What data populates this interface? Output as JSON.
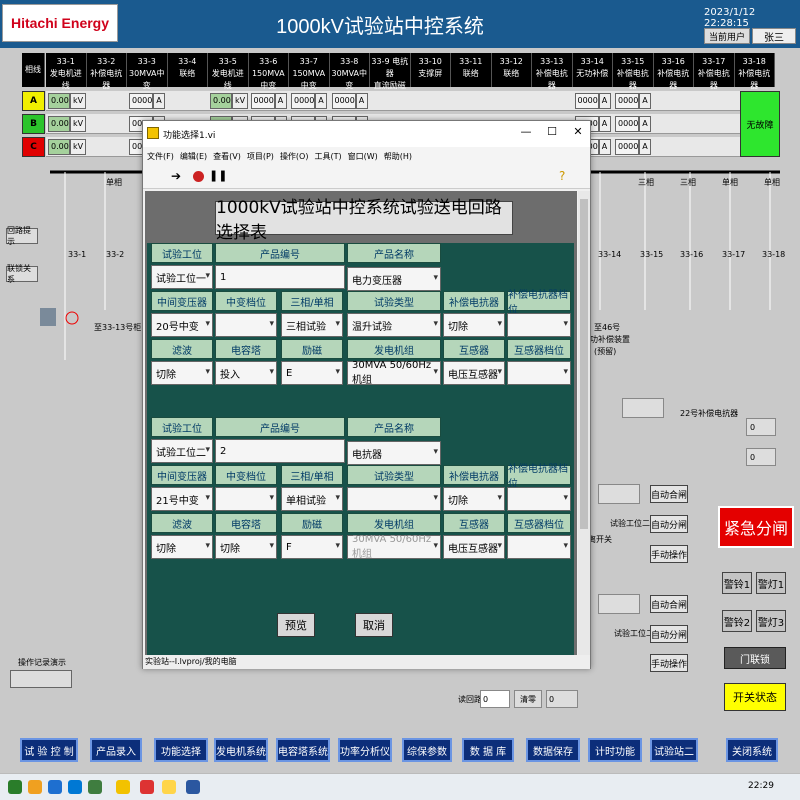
{
  "header": {
    "logo": "Hitachi Energy",
    "title": "1000kV试验站中控系统",
    "datetime": "2023/1/12 22:28:15",
    "user_label": "当前用户",
    "user_name": "张三"
  },
  "bus_table": {
    "phase_header": "相线",
    "columns": [
      {
        "id": "33-1",
        "name": "发电机进线"
      },
      {
        "id": "33-2",
        "name": "补偿电抗器"
      },
      {
        "id": "33-3",
        "name": "30MVA中变"
      },
      {
        "id": "33-4",
        "name": "联络"
      },
      {
        "id": "33-5",
        "name": "发电机进线"
      },
      {
        "id": "33-6",
        "name": "150MVA中变"
      },
      {
        "id": "33-7",
        "name": "150MVA中变"
      },
      {
        "id": "33-8",
        "name": "30MVA中变"
      },
      {
        "id": "33-9 电抗器",
        "name": "直流励磁"
      },
      {
        "id": "33-10",
        "name": "支撑屏"
      },
      {
        "id": "33-11",
        "name": "联络"
      },
      {
        "id": "33-12",
        "name": "联络"
      },
      {
        "id": "33-13",
        "name": "补偿电抗器"
      },
      {
        "id": "33-14",
        "name": "无功补偿"
      },
      {
        "id": "33-15",
        "name": "补偿电抗器"
      },
      {
        "id": "33-16",
        "name": "补偿电抗器"
      },
      {
        "id": "33-17",
        "name": "补偿电抗器"
      },
      {
        "id": "33-18",
        "name": "补偿电抗器"
      }
    ],
    "phases": [
      "A",
      "B",
      "C"
    ],
    "phase_colors": [
      "#f1ef00",
      "#2cc42c",
      "#e00000"
    ],
    "value_a": "0.00",
    "unit_kv": "kV",
    "value_b": "0000",
    "unit_a": "A",
    "status": "无故障"
  },
  "left_panel": {
    "btn_circuit": "回路提示",
    "btn_link": "联锁关系",
    "label_to": "至33-13号柜",
    "btn_log": "操作记录演示"
  },
  "diagram": {
    "labels": [
      "33-1",
      "33-2",
      "33-14",
      "33-15",
      "33-16",
      "33-17",
      "33-18",
      "三相",
      "三相",
      "三相",
      "单相",
      "单相",
      "单相"
    ],
    "to_46": "至46号",
    "to_46_2": "功补偿装置",
    "to_46_3": "(预留)",
    "reactor22": "22号补偿电抗器",
    "station2_a": "试验工位二",
    "station2_b": "试验工位二",
    "gate_switch": "离开关",
    "read_circuit": "读回路",
    "read_val": "0",
    "clear": "清零",
    "clear_val": "0"
  },
  "right_panel": {
    "val0_1": "0",
    "val0_2": "0",
    "auto_close": "自动合闸",
    "auto_open": "自动分闸",
    "manual": "手动操作",
    "emergency": "紧急分闸",
    "alarm1": "警铃1",
    "alarm_light1": "警灯1",
    "alarm2": "警铃2",
    "alarm_light3": "警灯3",
    "door_lock": "门联锁",
    "switch_status": "开关状态"
  },
  "nav": [
    "试 验 控 制",
    "产品录入",
    "功能选择",
    "发电机系统",
    "电容塔系统",
    "功率分析仪",
    "综保参数",
    "数 据 库",
    "数据保存",
    "计时功能",
    "试验站二",
    "关闭系统"
  ],
  "dialog": {
    "title": "功能选择1.vi",
    "menu": [
      "文件(F)",
      "编辑(E)",
      "查看(V)",
      "项目(P)",
      "操作(O)",
      "工具(T)",
      "窗口(W)",
      "帮助(H)"
    ],
    "heading": "1000kV试验站中控系统试验送电回路选择表",
    "status": "实验站--I.lvproj/我的电脑",
    "headers": {
      "station": "试验工位",
      "product_no": "产品编号",
      "product_name": "产品名称",
      "mid_trans": "中间变压器",
      "mid_tap": "中变档位",
      "phase": "三相/单相",
      "test_type": "试验类型",
      "comp_reactor": "补偿电抗器",
      "comp_tap": "补偿电抗器档位",
      "filter": "滤波",
      "cap_tower": "电容塔",
      "excite": "励磁",
      "gen_set": "发电机组",
      "transformer": "互感器",
      "trans_tap": "互感器档位"
    },
    "block1": {
      "station": "试验工位一",
      "product_no": "1",
      "product_name": "电力变压器",
      "mid_trans": "20号中变",
      "mid_tap": "",
      "phase": "三相试验",
      "test_type": "温升试验",
      "comp_reactor": "切除",
      "comp_tap": "",
      "filter": "切除",
      "cap_tower": "投入",
      "excite": "E",
      "gen_set": "30MVA 50/60Hz机组",
      "transformer": "电压互感器",
      "trans_tap": ""
    },
    "block2": {
      "station": "试验工位二",
      "product_no": "2",
      "product_name": "电抗器",
      "mid_trans": "21号中变",
      "mid_tap": "",
      "phase": "单相试验",
      "test_type": "",
      "comp_reactor": "切除",
      "comp_tap": "",
      "filter": "切除",
      "cap_tower": "切除",
      "excite": "F",
      "gen_set": "30MVA 50/60Hz机组",
      "transformer": "电压互感器",
      "trans_tap": ""
    },
    "preview": "预览",
    "cancel": "取消"
  },
  "taskbar": {
    "time": "22:29"
  }
}
